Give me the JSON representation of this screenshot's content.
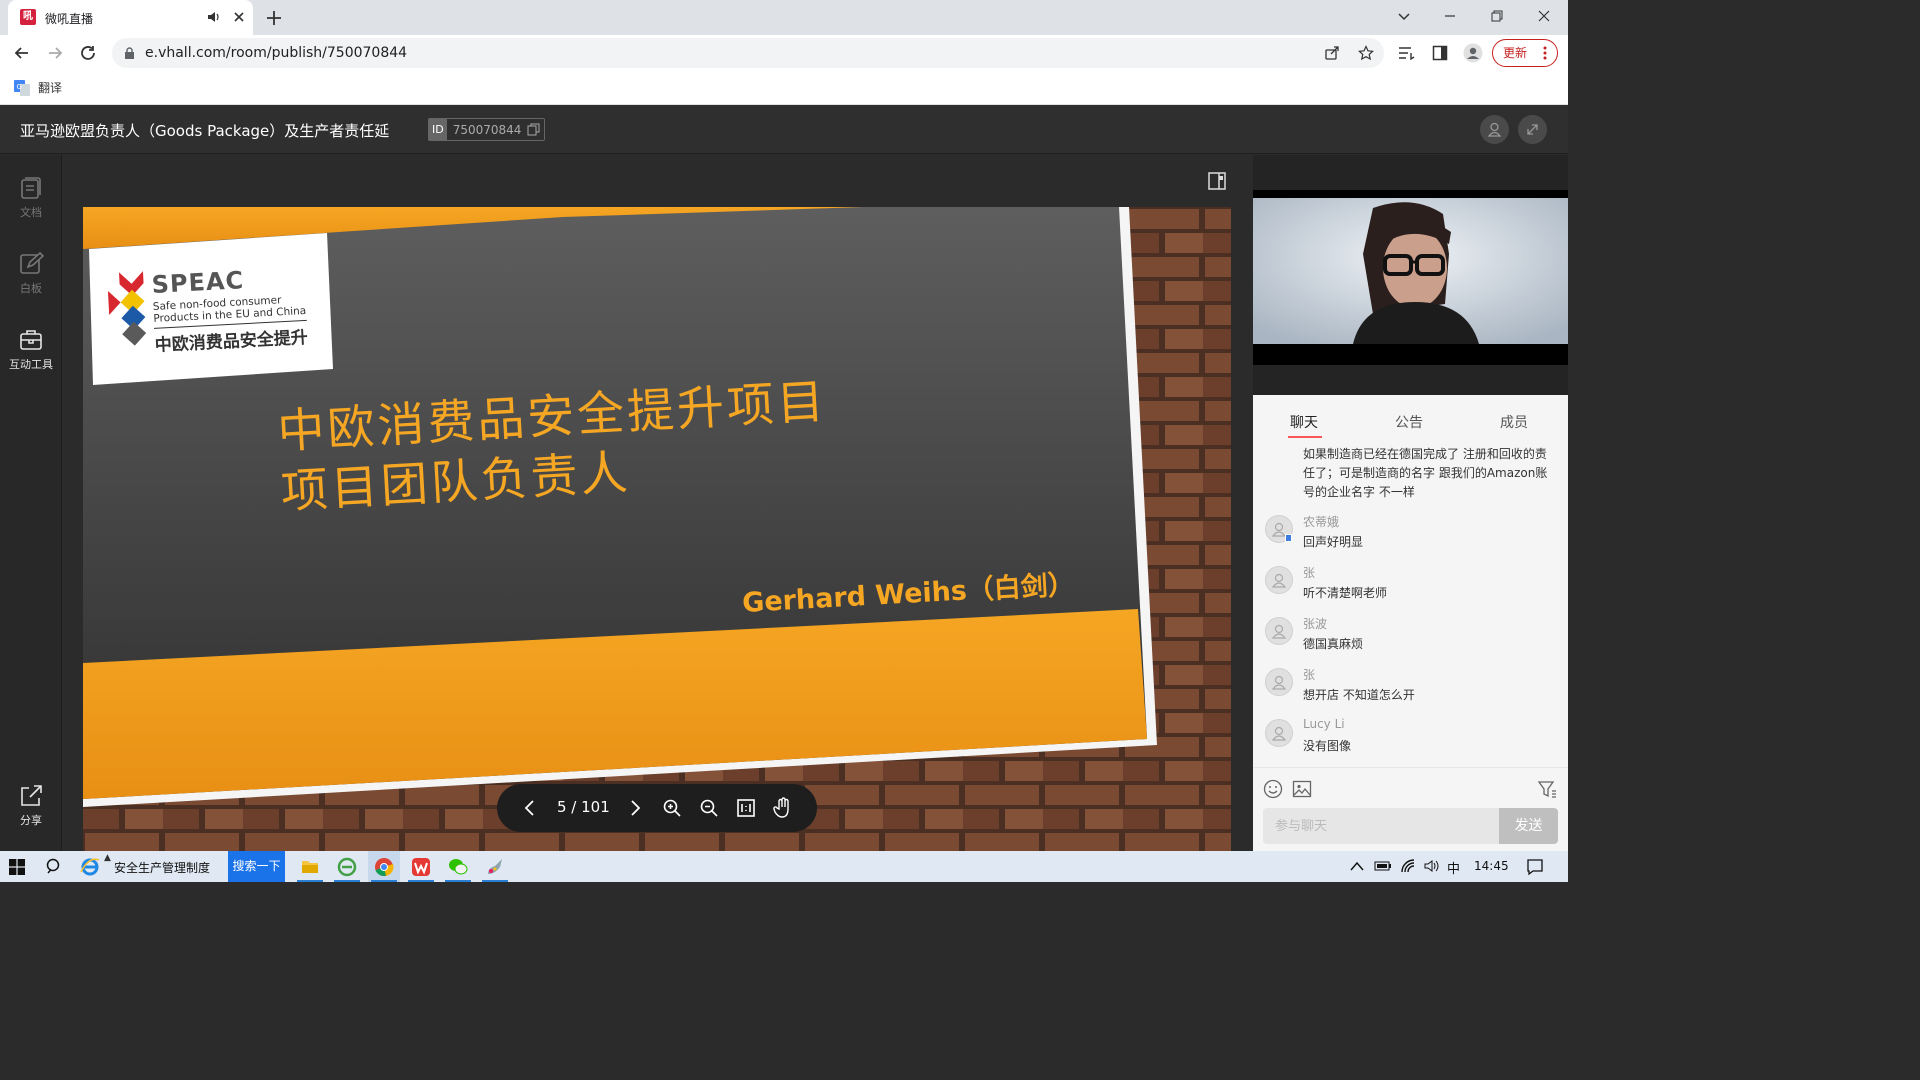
{
  "browser": {
    "tab_title": "微吼直播",
    "url": "e.vhall.com/room/publish/750070844",
    "update_label": "更新",
    "bookmark_translate": "翻译"
  },
  "room": {
    "title": "亚马逊欧盟负责人（Goods Package）及生产者责任延",
    "id_label": "ID",
    "id_value": "750070844"
  },
  "left_toolbar": {
    "items": [
      {
        "label": "文档",
        "icon": "document-icon"
      },
      {
        "label": "白板",
        "icon": "whiteboard-icon"
      },
      {
        "label": "互动工具",
        "icon": "toolbox-icon"
      }
    ],
    "share_label": "分享"
  },
  "slide": {
    "logo_name": "SPEAC",
    "logo_line1": "Safe non-food consumer",
    "logo_line2": "Products in the EU and China",
    "logo_cn": "中欧消费品安全提升",
    "heading1": "中欧消费品安全提升项目",
    "heading2": "项目团队负责人",
    "presenter": "Gerhard Weihs（白剑）"
  },
  "pager": {
    "page_text": "5 / 101",
    "current_page": 5,
    "total_pages": 101
  },
  "right_panel": {
    "tabs": [
      "聊天",
      "公告",
      "成员"
    ],
    "active_tab": "聊天",
    "first_message_line1": "如果制造商已经在德国完成了 注册和回收的责",
    "first_message_line2": "任了；可是制造商的名字 跟我们的Amazon账",
    "first_message_line3": "号的企业名字 不一样",
    "messages": [
      {
        "name": "农蒂娥",
        "text": "回声好明显"
      },
      {
        "name": "张",
        "text": "听不清楚啊老师"
      },
      {
        "name": "张波",
        "text": "德国真麻烦"
      },
      {
        "name": "张",
        "text": "想开店 不知道怎么开"
      },
      {
        "name": "Lucy Li",
        "text": "没有图像"
      }
    ],
    "chat_placeholder": "参与聊天",
    "send_label": "发送"
  },
  "taskbar": {
    "ie_label": "安全生产管理制度",
    "search_button": "搜索一下",
    "ime": "中",
    "time": "14:45"
  }
}
